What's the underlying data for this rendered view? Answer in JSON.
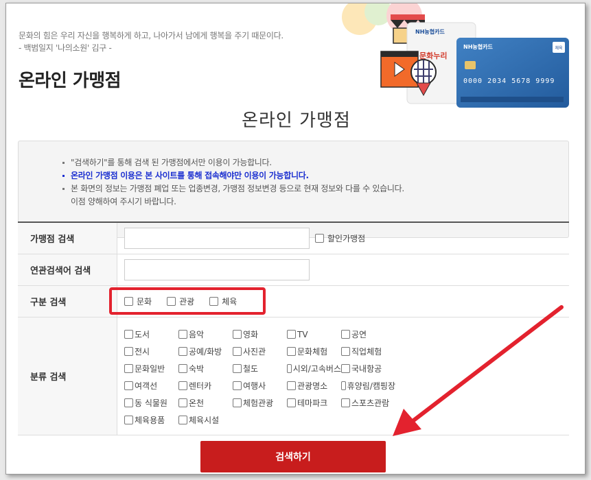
{
  "header": {
    "quote_line1": "문화의 힘은 우리 자신을 행복하게 하고, 나아가서 남에게 행복을 주기 때문이다.",
    "quote_line2": "- 백범일지 '나의소원' 김구 -",
    "page_title": "온라인 가맹점"
  },
  "banner": {
    "card_brand": "NH농협카드",
    "card_label": "문화누리",
    "card_number": "0000 2034 5678 9999",
    "card_tag": "체육"
  },
  "main": {
    "title": "온라인 가맹점",
    "notices": [
      "\"검색하기\"를 통해 검색 된 가맹점에서만 이용이 가능합니다.",
      "온라인 가맹점 이용은 본 사이트를 통해 접속해야만 이용이 가능합니다.",
      "본 화면의 정보는 가맹점 폐업 또는 업종변경, 가맹점 정보변경 등으로 현재 정보와 다를 수 있습니다.",
      "이점 양해하여 주시기 바랍니다."
    ]
  },
  "form": {
    "store_search_label": "가맹점 검색",
    "store_search_value": "",
    "discount_label": "할인가맹점",
    "related_search_label": "연관검색어 검색",
    "related_search_value": "",
    "type_label": "구분 검색",
    "types": [
      "문화",
      "관광",
      "체육"
    ],
    "category_label": "분류 검색",
    "categories": [
      "도서",
      "음악",
      "영화",
      "TV",
      "공연",
      "전시",
      "공예/화방",
      "사진관",
      "문화체험",
      "직업체험",
      "문화일반",
      "숙박",
      "철도",
      "시외/고속버스",
      "국내항공",
      "여객선",
      "렌터카",
      "여행사",
      "관광명소",
      "휴양림/캠핑장",
      "동 식물원",
      "온천",
      "체험관광",
      "테마파크",
      "스포츠관람",
      "체육용품",
      "체육시설"
    ],
    "search_button": "검색하기"
  },
  "colors": {
    "accent_red": "#c81d1d",
    "highlight_box": "#e3222e",
    "notice_blue": "#1b2fd0"
  }
}
